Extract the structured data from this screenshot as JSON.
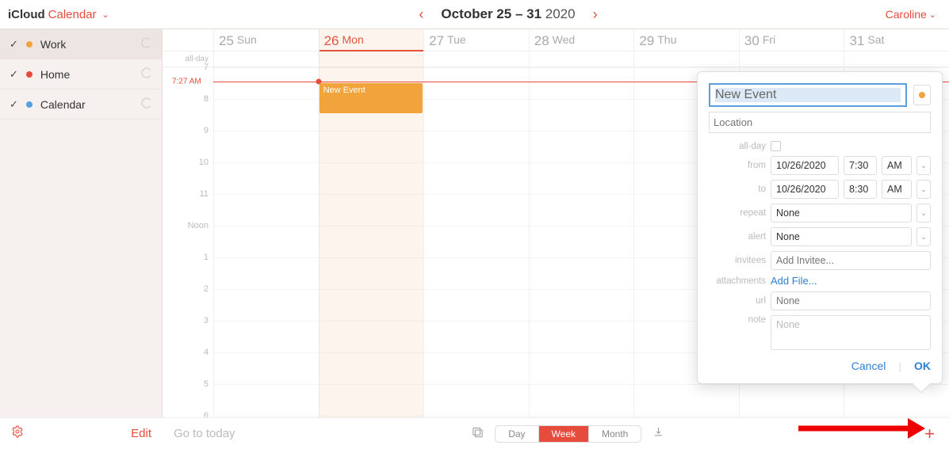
{
  "header": {
    "brand": "iCloud",
    "brand_app": "Calendar",
    "date_range_bold": "October 25 – 31",
    "date_range_year": "2020",
    "user_name": "Caroline"
  },
  "sidebar": {
    "calendars": [
      {
        "name": "Work",
        "color": "#f1a33c",
        "checked": true,
        "selected": true
      },
      {
        "name": "Home",
        "color": "#e64b3c",
        "checked": true,
        "selected": false
      },
      {
        "name": "Calendar",
        "color": "#5a9fe0",
        "checked": true,
        "selected": false
      }
    ],
    "edit_label": "Edit"
  },
  "week": {
    "allday_label": "all-day",
    "days": [
      {
        "num": "25",
        "dow": "Sun",
        "today": false
      },
      {
        "num": "26",
        "dow": "Mon",
        "today": true
      },
      {
        "num": "27",
        "dow": "Tue",
        "today": false
      },
      {
        "num": "28",
        "dow": "Wed",
        "today": false
      },
      {
        "num": "29",
        "dow": "Thu",
        "today": false
      },
      {
        "num": "30",
        "dow": "Fri",
        "today": false
      },
      {
        "num": "31",
        "dow": "Sat",
        "today": false
      }
    ],
    "hours": [
      "7",
      "8",
      "9",
      "10",
      "11",
      "Noon",
      "1",
      "2",
      "3",
      "4",
      "5",
      "6"
    ],
    "now_label": "7:27 AM"
  },
  "events": [
    {
      "title": "New Event",
      "day_index": 1,
      "start_hour_index": 0,
      "duration_hours": 1,
      "calendar_color": "#f1a33c"
    }
  ],
  "footer": {
    "goto_placeholder": "Go to today",
    "views": {
      "day": "Day",
      "week": "Week",
      "month": "Month",
      "active": "week"
    }
  },
  "popover": {
    "title_value": "New Event",
    "calendar_color": "#f1a33c",
    "location_placeholder": "Location",
    "labels": {
      "allday": "all-day",
      "from": "from",
      "to": "to",
      "repeat": "repeat",
      "alert": "alert",
      "invitees": "invitees",
      "attachments": "attachments",
      "url": "url",
      "note": "note"
    },
    "from": {
      "date": "10/26/2020",
      "time": "7:30",
      "ampm": "AM"
    },
    "to": {
      "date": "10/26/2020",
      "time": "8:30",
      "ampm": "AM"
    },
    "repeat_value": "None",
    "alert_value": "None",
    "invitees_placeholder": "Add Invitee...",
    "attachments_link": "Add File...",
    "url_placeholder": "None",
    "note_placeholder": "None",
    "cancel": "Cancel",
    "ok": "OK"
  }
}
